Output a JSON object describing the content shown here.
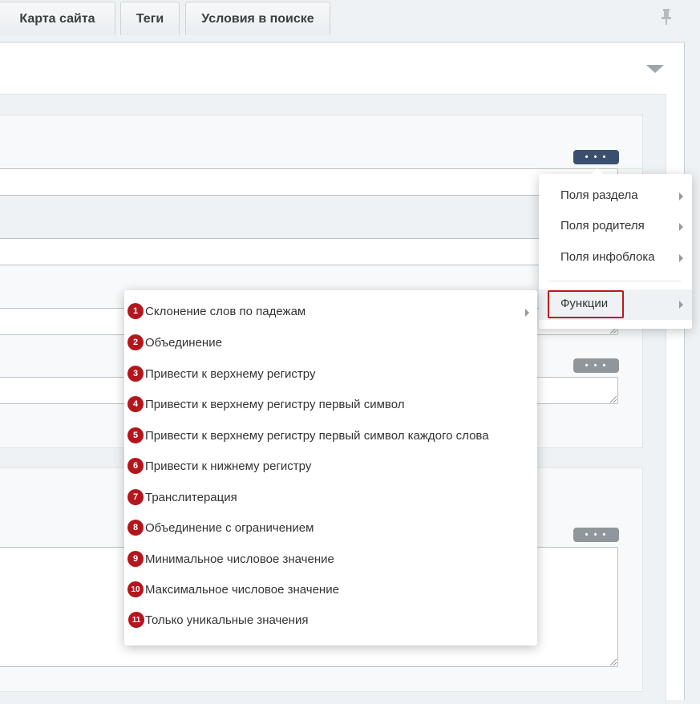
{
  "tabs": [
    {
      "label": "Карта сайта"
    },
    {
      "label": "Теги"
    },
    {
      "label": "Условия в поиске"
    }
  ],
  "dots_button_label": "• • •",
  "context_menu": {
    "items": [
      {
        "label": "Поля раздела"
      },
      {
        "label": "Поля родителя"
      },
      {
        "label": "Поля инфоблока"
      },
      {
        "label": "Функции"
      }
    ]
  },
  "functions_menu": {
    "items": [
      {
        "num": "1",
        "label": "Склонение слов по падежам"
      },
      {
        "num": "2",
        "label": "Объединение"
      },
      {
        "num": "3",
        "label": "Привести к верхнему регистру"
      },
      {
        "num": "4",
        "label": "Привести к верхнему регистру первый символ"
      },
      {
        "num": "5",
        "label": "Привести к верхнему регистру первый символ каждого слова"
      },
      {
        "num": "6",
        "label": "Привести к нижнему регистру"
      },
      {
        "num": "7",
        "label": "Транслитерация"
      },
      {
        "num": "8",
        "label": "Объединение с ограничением"
      },
      {
        "num": "9",
        "label": "Минимальное числовое значение"
      },
      {
        "num": "10",
        "label": "Максимальное числовое значение"
      },
      {
        "num": "11",
        "label": "Только уникальные значения"
      }
    ]
  },
  "colors": {
    "accent_badge": "#b3161c",
    "active_button": "#3a4f70",
    "inactive_button": "#8f979c"
  }
}
